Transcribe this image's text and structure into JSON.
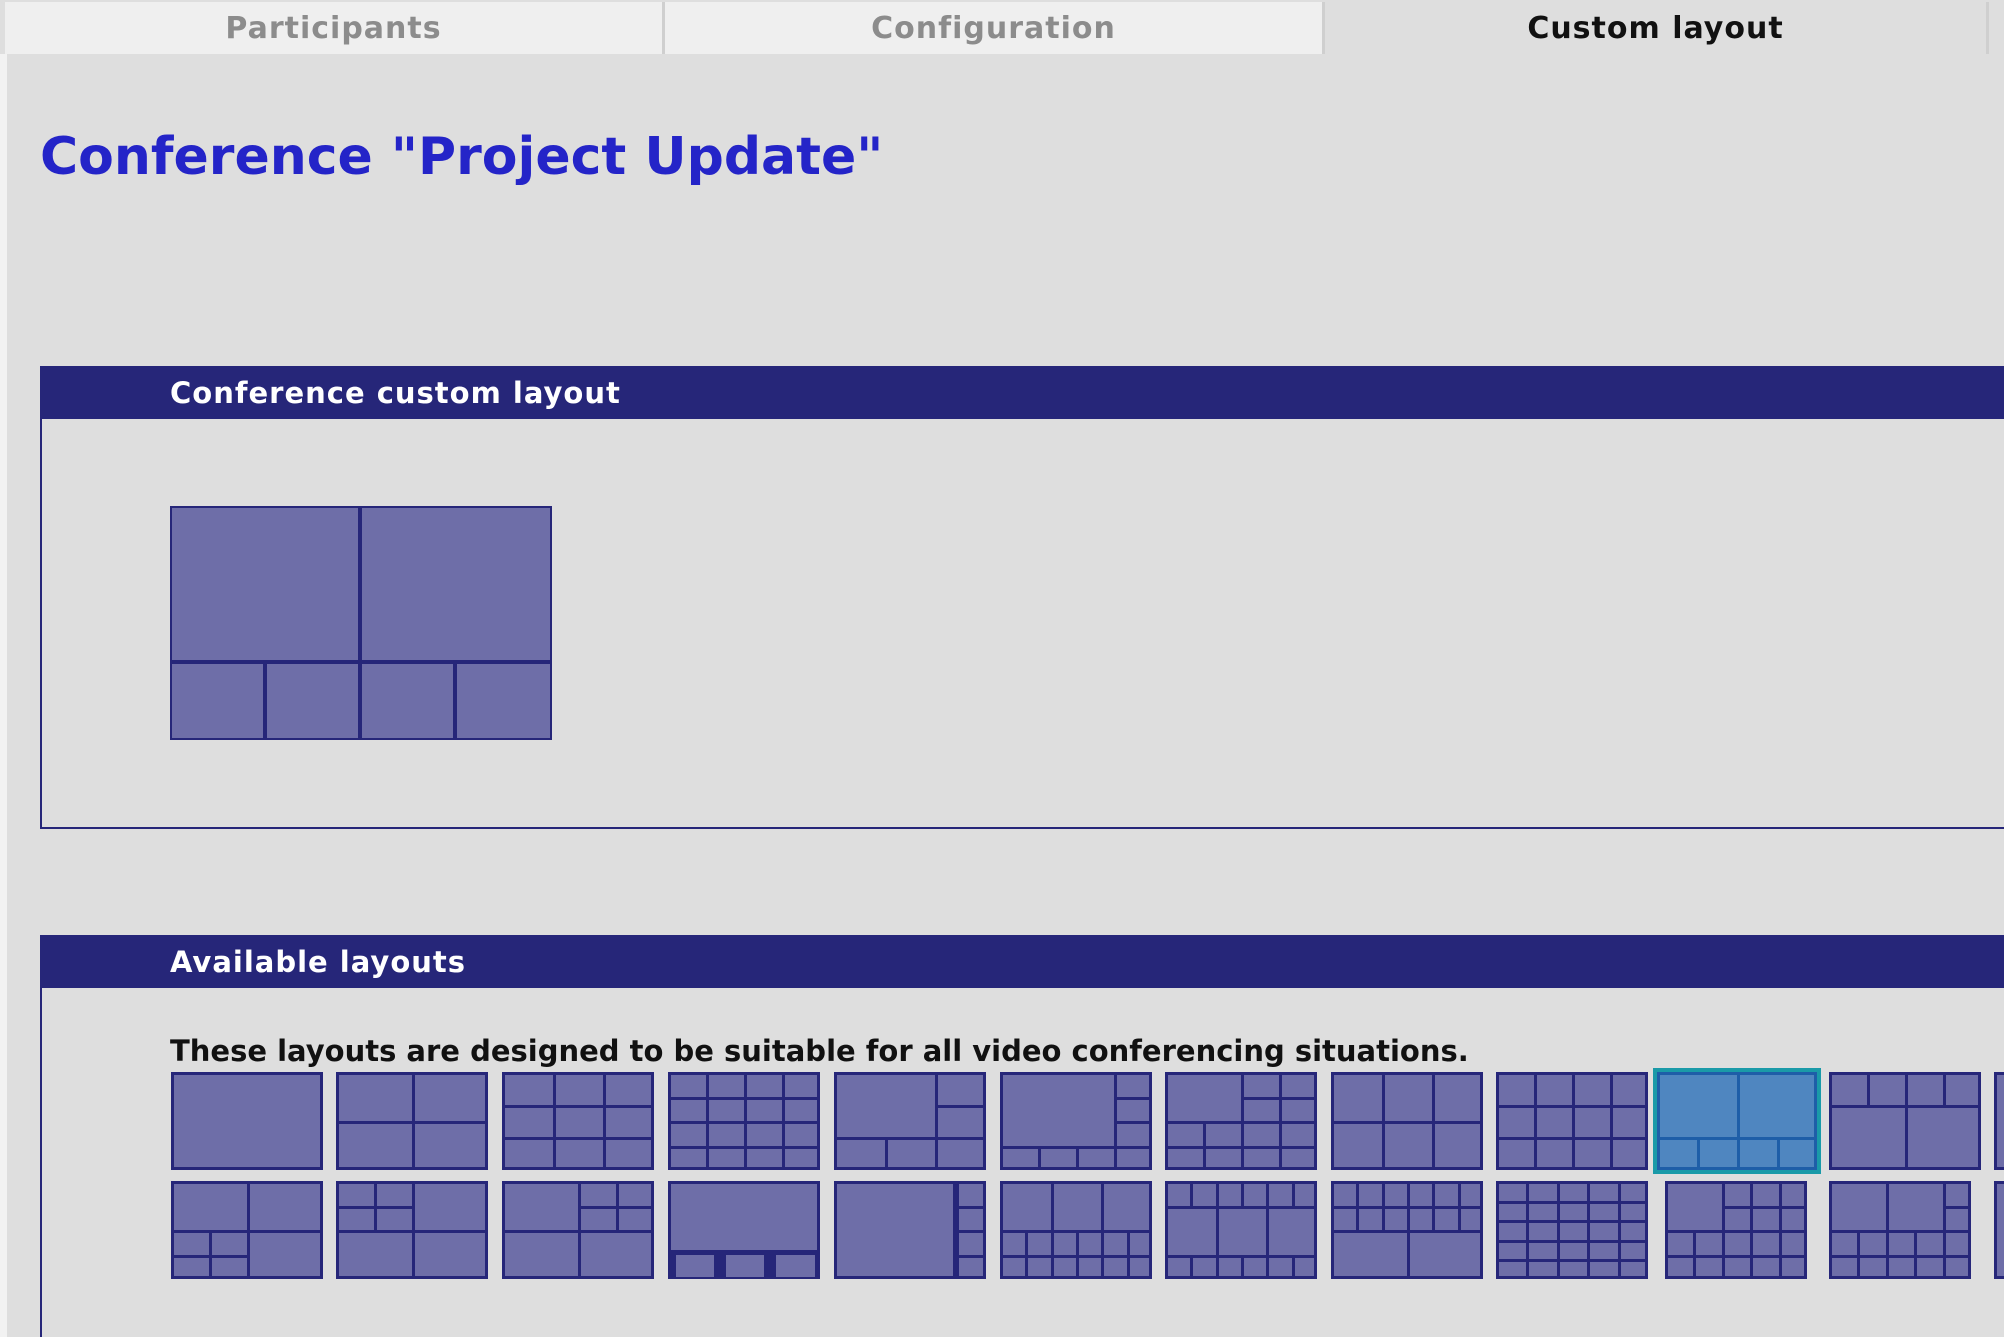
{
  "tabs": [
    {
      "label": "Participants",
      "active": false
    },
    {
      "label": "Configuration",
      "active": false
    },
    {
      "label": "Custom layout",
      "active": true
    }
  ],
  "title": "Conference \"Project Update\"",
  "custom_panel": {
    "header": "Conference custom layout"
  },
  "available_panel": {
    "header": "Available layouts",
    "description": "These layouts are designed to be suitable for all video conferencing situations.",
    "selected_index": 9
  },
  "colors": {
    "header_bg": "#262679",
    "cell": "#6e6ea8",
    "title": "#2424c8",
    "selected_outline": "#1a9aa8"
  }
}
